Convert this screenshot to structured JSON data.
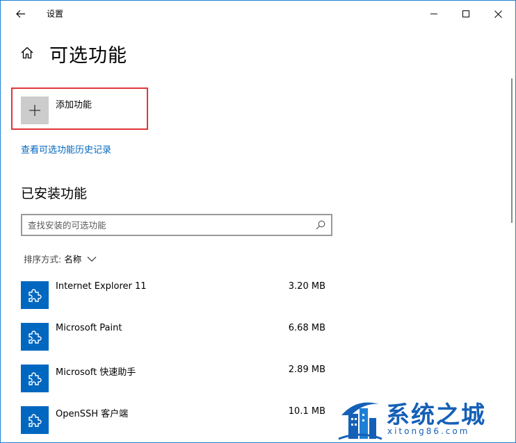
{
  "titlebar": {
    "app_title": "设置"
  },
  "header": {
    "title": "可选功能"
  },
  "add_feature": {
    "label": "添加功能"
  },
  "history_link": "查看可选功能历史记录",
  "installed": {
    "title": "已安装功能",
    "search_placeholder": "查找安装的可选功能",
    "sort_label": "排序方式:",
    "sort_value": "名称",
    "items": [
      {
        "name": "Internet Explorer 11",
        "size": "3.20 MB"
      },
      {
        "name": "Microsoft Paint",
        "size": "6.68 MB"
      },
      {
        "name": "Microsoft 快速助手",
        "size": "2.89 MB"
      },
      {
        "name": "OpenSSH 客户端",
        "size": "10.1 MB"
      }
    ]
  },
  "watermark": {
    "title": "系统之城",
    "subtitle": "xitong86.com"
  },
  "colors": {
    "accent": "#0067c0",
    "highlight_border": "#e0363a",
    "window_border": "#1f7fd0",
    "add_tile": "#cccccc"
  },
  "icons": [
    "back-arrow-icon",
    "minimize-icon",
    "maximize-icon",
    "close-icon",
    "home-icon",
    "plus-icon",
    "search-icon",
    "chevron-down-icon",
    "puzzle-icon"
  ]
}
